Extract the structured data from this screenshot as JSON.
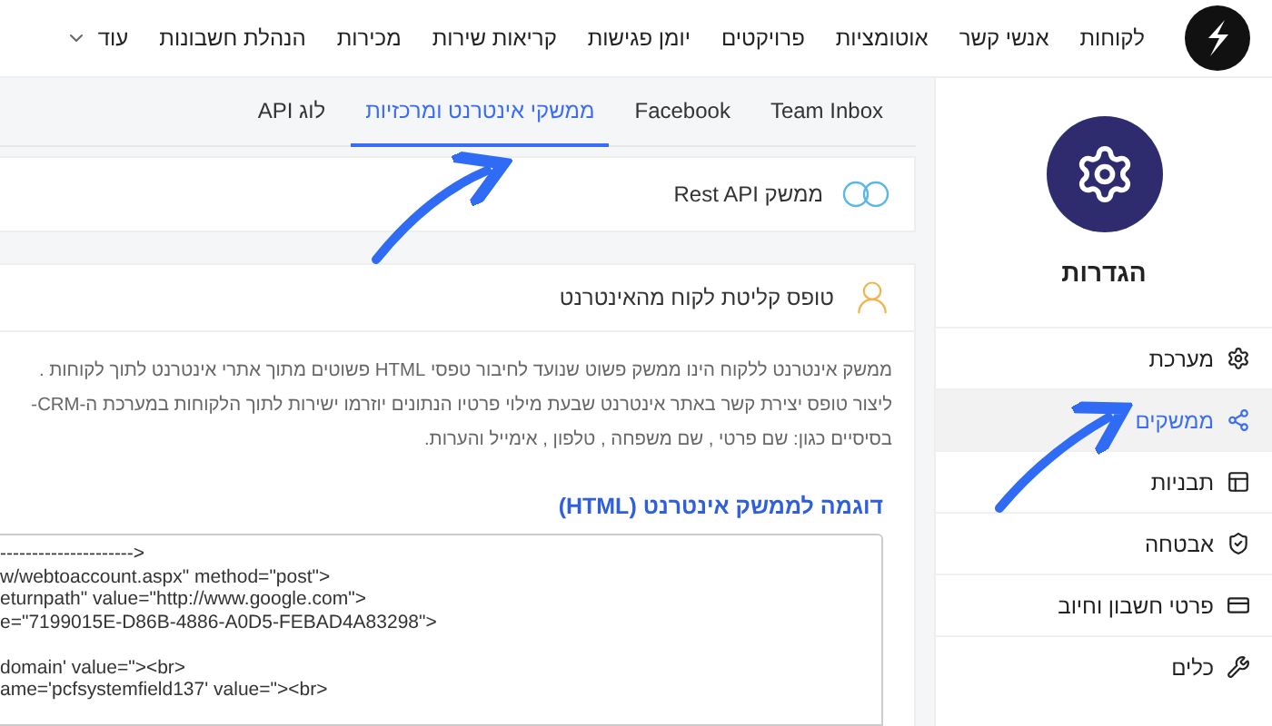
{
  "top_nav": {
    "items": [
      {
        "label": "לקוחות"
      },
      {
        "label": "אנשי קשר"
      },
      {
        "label": "אוטומציות"
      },
      {
        "label": "פרויקטים"
      },
      {
        "label": "יומן פגישות"
      },
      {
        "label": "קריאות שירות"
      },
      {
        "label": "מכירות"
      },
      {
        "label": "הנהלת חשבונות"
      }
    ],
    "more": {
      "label": "עוד"
    }
  },
  "sidebar": {
    "title": "הגדרות",
    "items": [
      {
        "label": "מערכת",
        "kind": "gear",
        "selected": false
      },
      {
        "label": "ממשקים",
        "kind": "share",
        "selected": true
      },
      {
        "label": "תבניות",
        "kind": "layout",
        "selected": false
      },
      {
        "label": "אבטחה",
        "kind": "shield",
        "selected": false
      },
      {
        "label": "פרטי חשבון וחיוב",
        "kind": "card",
        "selected": false
      },
      {
        "label": "כלים",
        "kind": "tools",
        "selected": false
      }
    ]
  },
  "tabs": [
    {
      "label": "Team Inbox",
      "selected": false
    },
    {
      "label": "Facebook",
      "selected": false
    },
    {
      "label": "ממשקי אינטרנט ומרכזיות",
      "selected": true
    },
    {
      "label": "לוג API",
      "selected": false
    }
  ],
  "rest_card": {
    "title": "ממשק Rest API"
  },
  "form_card": {
    "title": "טופס קליטת לקוח מהאינטרנט",
    "description": [
      "ממשק אינטרנט ללקוח הינו ממשק פשוט שנועד לחיבור טפסי HTML פשוטים מתוך אתרי אינטרנט לתוך לקוחות .",
      "ליצור טופס יצירת קשר באתר אינטרנט שבעת מילוי פרטיו הנתונים יוזרמו ישירות לתוך הלקוחות במערכת ה-CRM-",
      "בסיסיים כגון: שם פרטי , שם משפחה , טלפון , אימייל והערות."
    ],
    "example_heading": "דוגמה לממשק אינטרנט (HTML)",
    "code_blocks": [
      [
        "--------------------->",
        "w/webtoaccount.aspx\" method=\"post\">",
        "eturnpath\" value=\"http://www.google.com\">",
        "e=\"7199015E-D86B-4886-A0D5-FEBAD4A83298\">"
      ],
      [
        "domain' value=\"><br>",
        "ame='pcfsystemfield137' value=\"><br>"
      ]
    ]
  }
}
